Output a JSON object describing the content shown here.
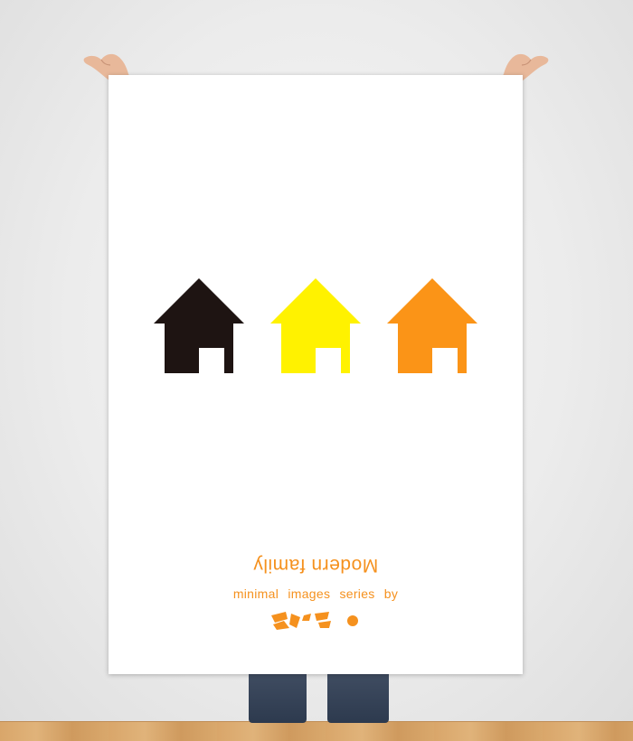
{
  "poster": {
    "title": "Modern family",
    "subtitle": "minimal images series by",
    "logo_icon": "abstract-logo-icon",
    "houses": [
      {
        "icon": "house-icon",
        "color": "#1e1412"
      },
      {
        "icon": "house-icon",
        "color": "#fff200"
      },
      {
        "icon": "house-icon",
        "color": "#fb9417"
      }
    ]
  },
  "colors": {
    "text_accent": "#f5911e",
    "wall": "#ececec",
    "floor": "#d9a66a",
    "jeans": "#34425a"
  }
}
